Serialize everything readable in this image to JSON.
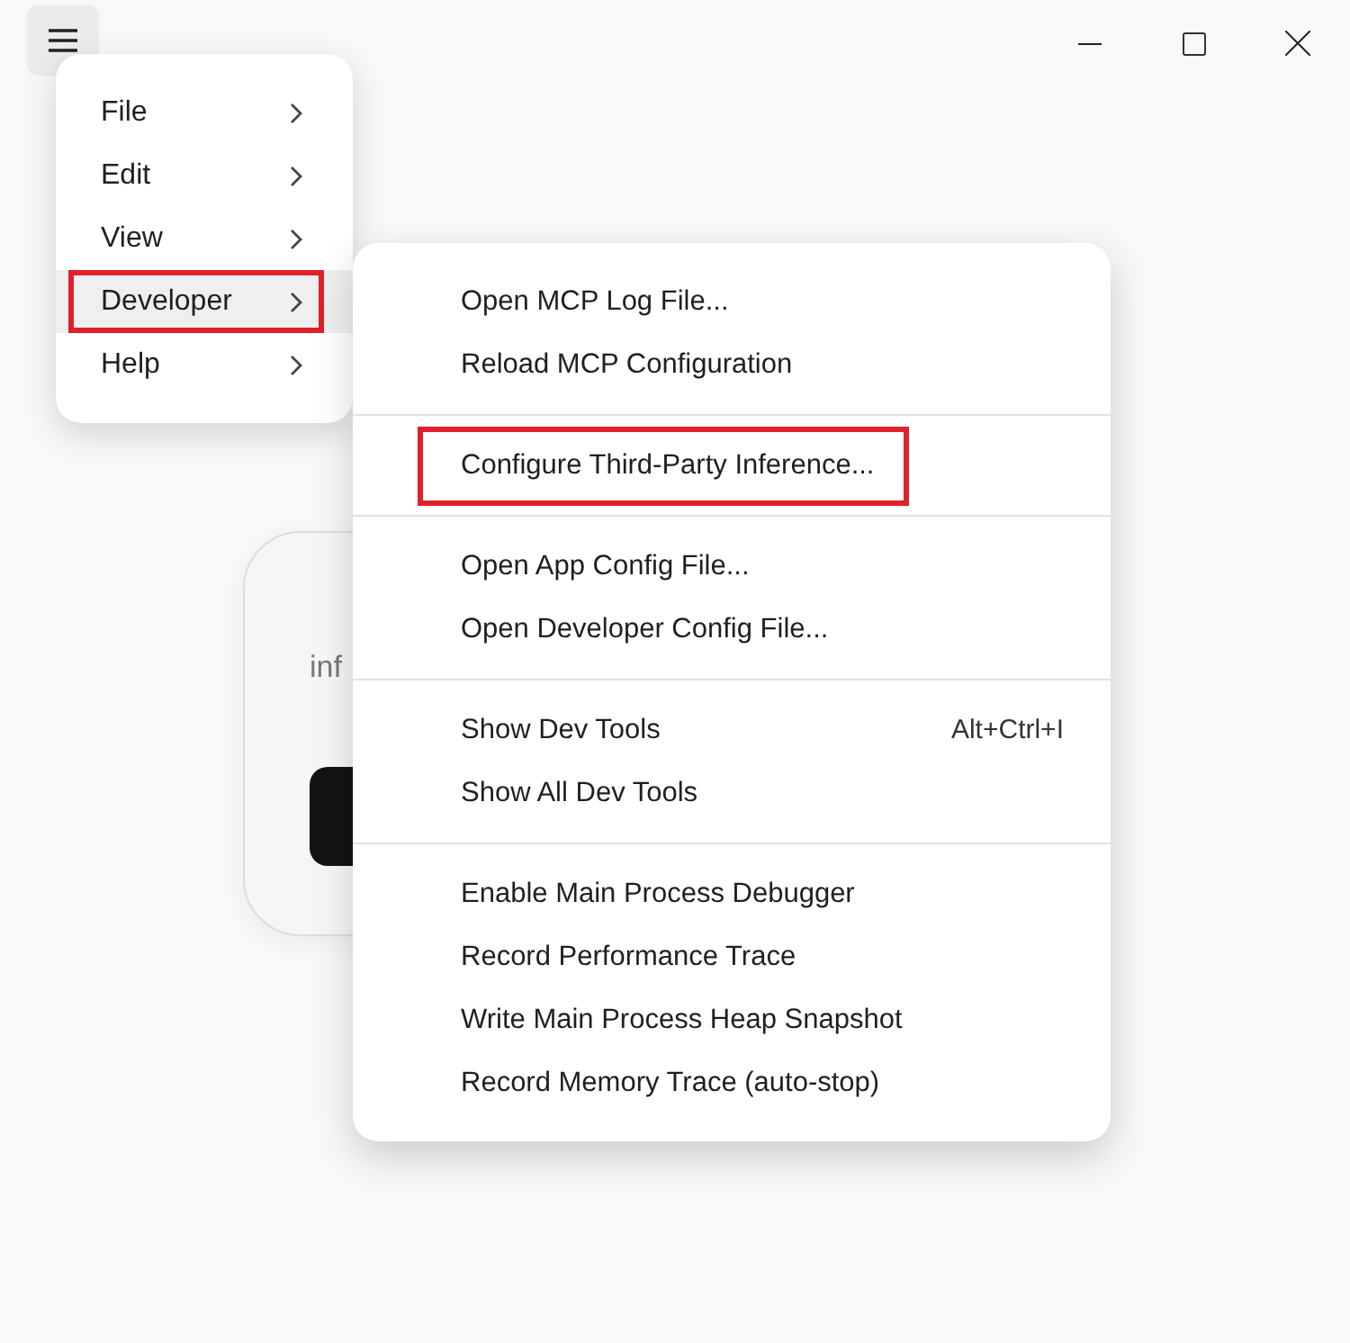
{
  "background_card": {
    "text_lines": [
      "inf"
    ]
  },
  "menu": {
    "items": [
      {
        "label": "File",
        "selected": false,
        "highlighted": false
      },
      {
        "label": "Edit",
        "selected": false,
        "highlighted": false
      },
      {
        "label": "View",
        "selected": false,
        "highlighted": false
      },
      {
        "label": "Developer",
        "selected": true,
        "highlighted": true
      },
      {
        "label": "Help",
        "selected": false,
        "highlighted": false
      }
    ]
  },
  "submenu": {
    "sections": [
      [
        {
          "label": "Open MCP Log File...",
          "highlighted": false
        },
        {
          "label": "Reload MCP Configuration",
          "highlighted": false
        }
      ],
      [
        {
          "label": "Configure Third-Party Inference...",
          "highlighted": true
        }
      ],
      [
        {
          "label": "Open App Config File...",
          "highlighted": false
        },
        {
          "label": "Open Developer Config File...",
          "highlighted": false
        }
      ],
      [
        {
          "label": "Show Dev Tools",
          "shortcut": "Alt+Ctrl+I",
          "highlighted": false
        },
        {
          "label": "Show All Dev Tools",
          "highlighted": false
        }
      ],
      [
        {
          "label": "Enable Main Process Debugger",
          "highlighted": false
        },
        {
          "label": "Record Performance Trace",
          "highlighted": false
        },
        {
          "label": "Write Main Process Heap Snapshot",
          "highlighted": false
        },
        {
          "label": "Record Memory Trace (auto-stop)",
          "highlighted": false
        }
      ]
    ]
  }
}
